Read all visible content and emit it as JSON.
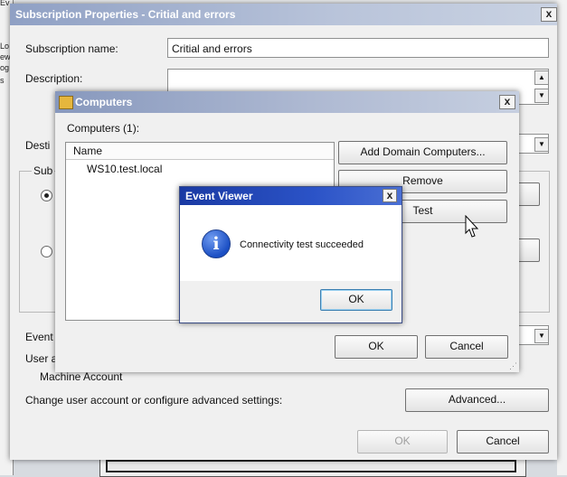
{
  "background": {
    "left_fragments": [
      "Ev",
      "Lo",
      "ew",
      "og",
      "s"
    ]
  },
  "subscription_dialog": {
    "title": "Subscription Properties - Critial and errors",
    "close_glyph": "x",
    "name_label": "Subscription name:",
    "name_value": "Critial and errors",
    "description_label": "Description:",
    "destination_label_partial": "Desti",
    "subscription_group_partial": "Sub",
    "events_label_partial": "Event",
    "user_label_partial": "User a",
    "machine_account_label": "Machine Account",
    "advanced_settings_label": "Change user account or configure advanced settings:",
    "advanced_button": "Advanced...",
    "ok_button": "OK",
    "cancel_button": "Cancel"
  },
  "computers_dialog": {
    "title": "Computers",
    "close_glyph": "x",
    "count_label": "Computers (1):",
    "column_name": "Name",
    "items": [
      "WS10.test.local"
    ],
    "add_domain_button": "Add Domain Computers...",
    "remove_button": "Remove",
    "test_button": "Test",
    "ok_button": "OK",
    "cancel_button": "Cancel"
  },
  "event_viewer_dialog": {
    "title": "Event Viewer",
    "close_glyph": "x",
    "message": "Connectivity test succeeded",
    "info_glyph": "i",
    "ok_button": "OK"
  },
  "colors": {
    "titlebar_active": "#1f3fa8",
    "titlebar_inactive": "#9aa7c2",
    "dialog_bg": "#f0f0f0"
  }
}
